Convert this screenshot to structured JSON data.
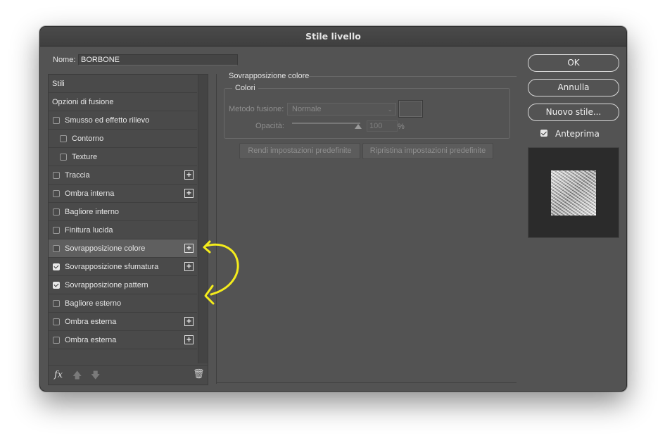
{
  "window": {
    "title": "Stile livello"
  },
  "name_field": {
    "label": "Nome:",
    "value": "BORBONE"
  },
  "styles": {
    "items": [
      {
        "label": "Stili"
      },
      {
        "label": "Opzioni di fusione"
      },
      {
        "label": "Smusso ed effetto rilievo",
        "checked": false
      },
      {
        "label": "Contorno",
        "checked": false
      },
      {
        "label": "Texture",
        "checked": false
      },
      {
        "label": "Traccia",
        "checked": false
      },
      {
        "label": "Ombra interna",
        "checked": false
      },
      {
        "label": "Bagliore interno",
        "checked": false
      },
      {
        "label": "Finitura lucida",
        "checked": false
      },
      {
        "label": "Sovrapposizione colore",
        "checked": false,
        "selected": true
      },
      {
        "label": "Sovrapposizione sfumatura",
        "checked": true
      },
      {
        "label": "Sovrapposizione pattern",
        "checked": true
      },
      {
        "label": "Bagliore esterno",
        "checked": false
      },
      {
        "label": "Ombra esterna",
        "checked": false
      },
      {
        "label": "Ombra esterna",
        "checked": false
      }
    ],
    "footer": {
      "fx_label": "fx"
    }
  },
  "color_overlay": {
    "section_title": "Sovrapposizione colore",
    "group_title": "Colori",
    "blend_mode_label": "Metodo fusione:",
    "blend_mode_value": "Normale",
    "opacity_label": "Opacità:",
    "opacity_value": "100",
    "opacity_unit": "%",
    "opacity_level_percent": 100,
    "reset_button": "Rendi impostazioni predefinite",
    "restore_button": "Ripristina impostazioni predefinite"
  },
  "actions": {
    "ok": "OK",
    "cancel": "Annulla",
    "new_style": "Nuovo stile...",
    "preview_label": "Anteprima",
    "preview_checked": true
  },
  "annotation_color": "#f4ec1c"
}
